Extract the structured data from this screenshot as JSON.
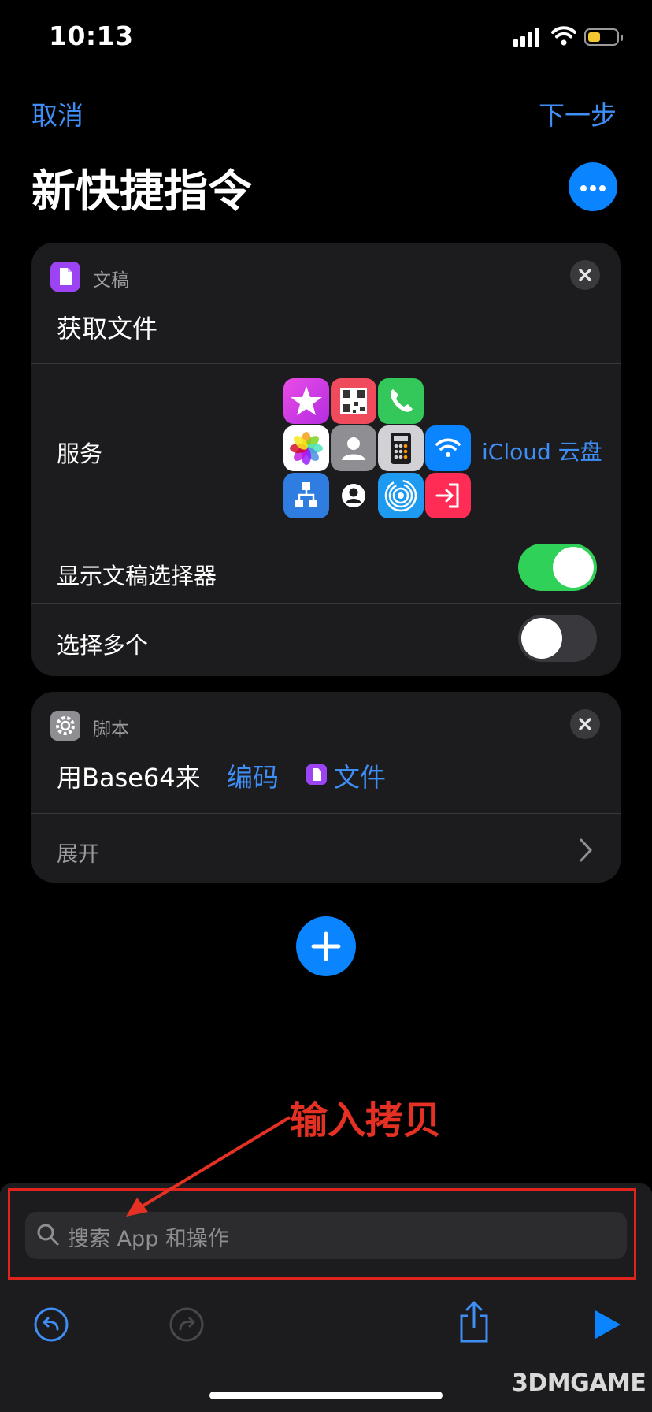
{
  "status_bar": {
    "time": "10:13",
    "battery_color": "#f4c730"
  },
  "nav": {
    "cancel_label": "取消",
    "next_label": "下一步",
    "title": "新快捷指令",
    "more_icon": "ellipsis-icon"
  },
  "action_get_file": {
    "category": "文稿",
    "title": "获取文件",
    "service_label": "服务",
    "service_value": "iCloud 云盘",
    "service_apps": [
      "itunes-star-icon",
      "qr-code-icon",
      "phone-icon",
      "photos-icon",
      "contacts-icon",
      "calculator-icon",
      "wifi-icon",
      "shortcuts-icon",
      "person-circle-icon",
      "airdrop-icon",
      "exit-icon"
    ],
    "show_picker_label": "显示文稿选择器",
    "show_picker_on": true,
    "select_multiple_label": "选择多个",
    "select_multiple_on": false
  },
  "action_base64": {
    "category": "脚本",
    "prefix": "用Base64来",
    "mode_token": "编码",
    "file_token": "文件",
    "expand_label": "展开"
  },
  "bottom": {
    "search_placeholder": "搜索 App 和操作"
  },
  "annotation": {
    "text": "输入拷贝",
    "color": "#e53123"
  },
  "watermark": {
    "text": "3DMGAME"
  },
  "colors": {
    "accent": "#0a84ff",
    "link": "#3f8ef5",
    "toggle_on": "#30d158"
  }
}
